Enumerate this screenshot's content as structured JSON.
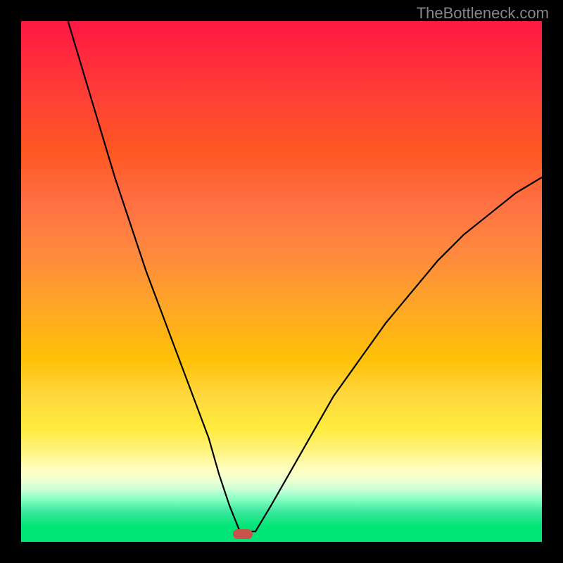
{
  "watermark": "TheBottleneck.com",
  "colors": {
    "background": "#000000",
    "curve": "#000000",
    "marker": "#c9534b"
  },
  "chart_data": {
    "type": "line",
    "title": "",
    "xlabel": "",
    "ylabel": "",
    "xlim": [
      0,
      100
    ],
    "ylim": [
      0,
      100
    ],
    "grid": false,
    "legend": false,
    "annotations": [
      {
        "type": "marker",
        "x": 42.5,
        "y": 1.5
      }
    ],
    "series": [
      {
        "name": "bottleneck-curve",
        "x": [
          9,
          12,
          15,
          18,
          21,
          24,
          27,
          30,
          33,
          36,
          38,
          40,
          42,
          45,
          48,
          52,
          56,
          60,
          65,
          70,
          75,
          80,
          85,
          90,
          95,
          100
        ],
        "y": [
          100,
          90,
          80,
          70,
          61,
          52,
          44,
          36,
          28,
          20,
          13,
          7,
          2,
          2,
          7,
          14,
          21,
          28,
          35,
          42,
          48,
          54,
          59,
          63,
          67,
          70
        ]
      }
    ],
    "background_gradient": {
      "orientation": "vertical",
      "stops": [
        {
          "pos": 0,
          "color": "#ff1744"
        },
        {
          "pos": 50,
          "color": "#ff9800"
        },
        {
          "pos": 78,
          "color": "#ffeb3b"
        },
        {
          "pos": 88,
          "color": "#ffffd0"
        },
        {
          "pos": 100,
          "color": "#00e676"
        }
      ]
    }
  }
}
